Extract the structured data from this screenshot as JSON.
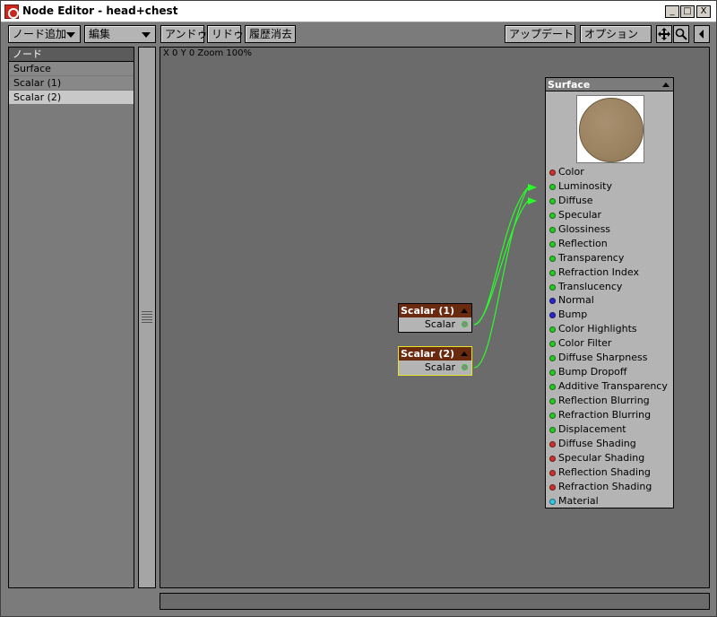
{
  "window": {
    "title": "Node Editor - head+chest",
    "controls": {
      "minimize": "_",
      "maximize": "□",
      "close": "X"
    }
  },
  "toolbar": {
    "add_node": "ノード追加",
    "edit": "編集",
    "undo": "アンドゥ",
    "redo": "リドゥ",
    "clear_history": "履歴消去",
    "update": "アップデート",
    "options": "オプション"
  },
  "node_list": {
    "header": "ノード",
    "items": [
      {
        "label": "Surface",
        "selected": false
      },
      {
        "label": "Scalar (1)",
        "selected": false
      },
      {
        "label": "Scalar (2)",
        "selected": true
      }
    ]
  },
  "canvas": {
    "status": "X 0  Y 0  Zoom 100%",
    "nodes": [
      {
        "title": "Scalar (1)",
        "output": "Scalar",
        "active": false
      },
      {
        "title": "Scalar (2)",
        "output": "Scalar",
        "active": true
      }
    ],
    "surface": {
      "title": "Surface",
      "preview_color": "#9c8462",
      "inputs": [
        {
          "label": "Color",
          "color": "#c83232"
        },
        {
          "label": "Luminosity",
          "color": "#28c828"
        },
        {
          "label": "Diffuse",
          "color": "#28c828"
        },
        {
          "label": "Specular",
          "color": "#28c828"
        },
        {
          "label": "Glossiness",
          "color": "#28c828"
        },
        {
          "label": "Reflection",
          "color": "#28c828"
        },
        {
          "label": "Transparency",
          "color": "#28c828"
        },
        {
          "label": "Refraction Index",
          "color": "#28c828"
        },
        {
          "label": "Translucency",
          "color": "#28c828"
        },
        {
          "label": "Normal",
          "color": "#2828c8"
        },
        {
          "label": "Bump",
          "color": "#2828c8"
        },
        {
          "label": "Color Highlights",
          "color": "#28c828"
        },
        {
          "label": "Color Filter",
          "color": "#28c828"
        },
        {
          "label": "Diffuse Sharpness",
          "color": "#28c828"
        },
        {
          "label": "Bump Dropoff",
          "color": "#28c828"
        },
        {
          "label": "Additive Transparency",
          "color": "#28c828"
        },
        {
          "label": "Reflection Blurring",
          "color": "#28c828"
        },
        {
          "label": "Refraction Blurring",
          "color": "#28c828"
        },
        {
          "label": "Displacement",
          "color": "#28c828"
        },
        {
          "label": "Diffuse Shading",
          "color": "#c83232"
        },
        {
          "label": "Specular Shading",
          "color": "#c83232"
        },
        {
          "label": "Reflection Shading",
          "color": "#c83232"
        },
        {
          "label": "Refraction Shading",
          "color": "#c83232"
        },
        {
          "label": "Material",
          "color": "#32c8e6"
        }
      ]
    },
    "connections": [
      {
        "from": "Scalar (1)",
        "to": "Luminosity"
      },
      {
        "from": "Scalar (1)",
        "to": "Diffuse"
      },
      {
        "from": "Scalar (2)",
        "to": "Luminosity"
      }
    ]
  },
  "colors": {
    "wire": "#28ff28",
    "scalar_header": "#6a2a10",
    "active_outline": "#e5e52a"
  }
}
